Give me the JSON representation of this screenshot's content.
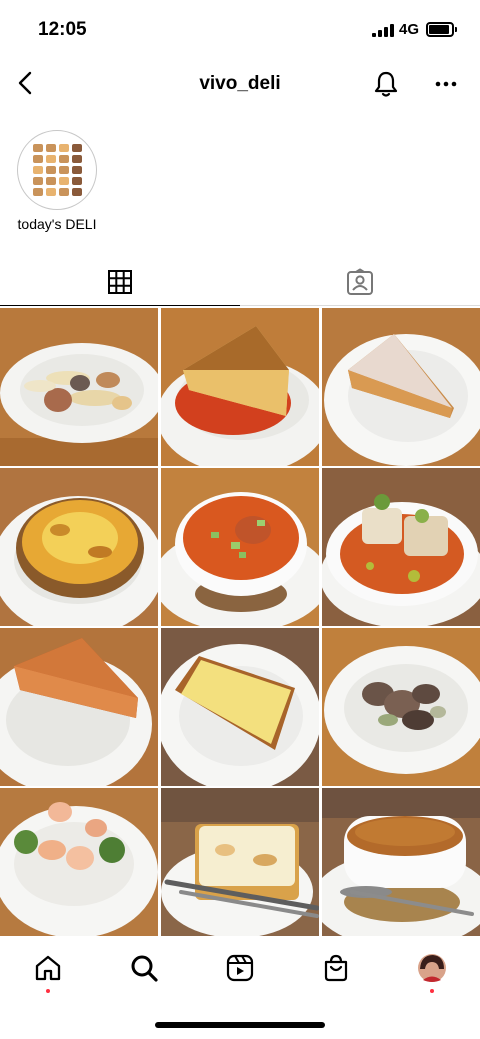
{
  "status_bar": {
    "time": "12:05",
    "network": "4G"
  },
  "header": {
    "username": "vivo_deli"
  },
  "highlights": [
    {
      "label": "today's DELI"
    }
  ],
  "tabs": [
    {
      "icon": "grid-icon",
      "active": true
    },
    {
      "icon": "tagged-icon",
      "active": false
    }
  ],
  "posts": [
    {
      "dish": "vegetables-and-mushroom-saute"
    },
    {
      "dish": "frittata-on-tomato-sauce"
    },
    {
      "dish": "custard-tart-slice"
    },
    {
      "dish": "baked-gratin-pie"
    },
    {
      "dish": "gazpacho-soup-cup"
    },
    {
      "dish": "fish-on-tomato-sauce"
    },
    {
      "dish": "quiche-slice"
    },
    {
      "dish": "pound-cake-slice"
    },
    {
      "dish": "braised-mushrooms"
    },
    {
      "dish": "shrimp-and-broccoli"
    },
    {
      "dish": "lasagna"
    },
    {
      "dish": "soup-cup"
    }
  ],
  "bottom_nav": [
    "home-icon",
    "search-icon",
    "reels-icon",
    "shop-icon",
    "profile-avatar"
  ],
  "colors": {
    "notification_dot": "#ff3040",
    "wood_table": "#b8793c"
  }
}
